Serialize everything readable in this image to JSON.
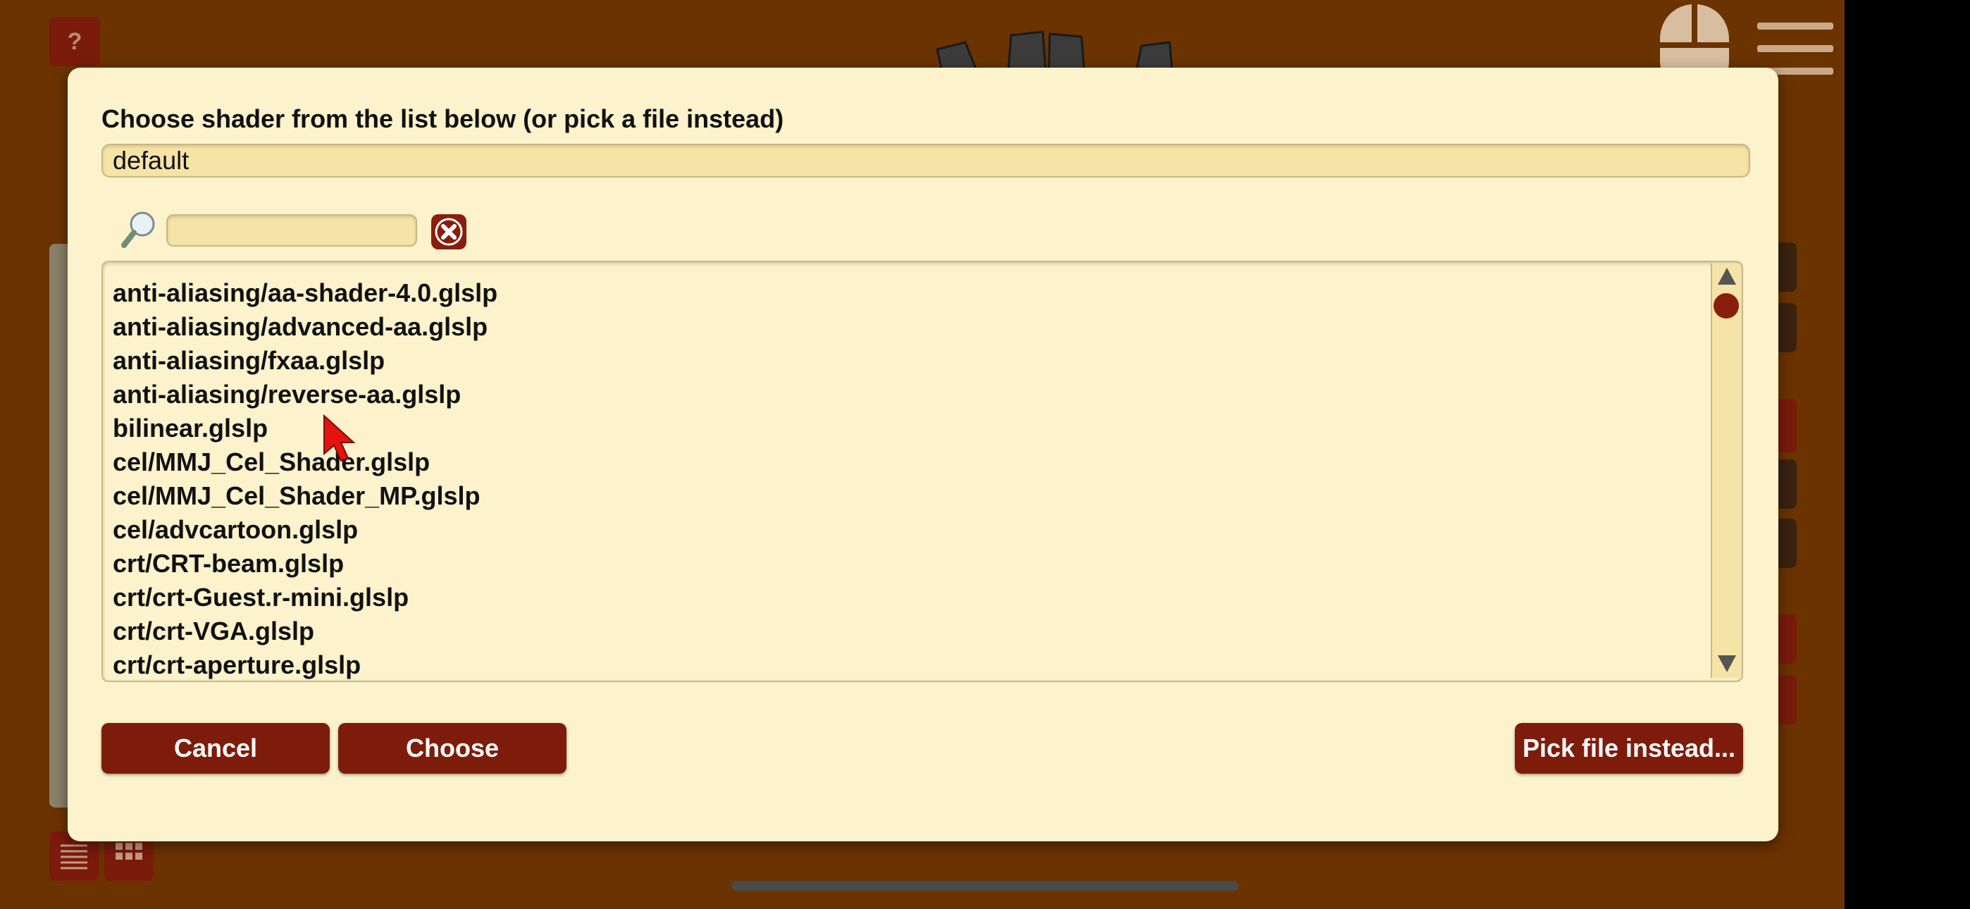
{
  "app": {
    "help_label": "?",
    "accent_color": "#7e1c0c",
    "background_color": "#6b3300"
  },
  "dialog": {
    "prompt": "Choose shader from the list below (or pick a file instead)",
    "selected_value": "default",
    "search": {
      "placeholder": "",
      "value": ""
    },
    "items": [
      "anti-aliasing/aa-shader-4.0.glslp",
      "anti-aliasing/advanced-aa.glslp",
      "anti-aliasing/fxaa.glslp",
      "anti-aliasing/reverse-aa.glslp",
      "bilinear.glslp",
      "cel/MMJ_Cel_Shader.glslp",
      "cel/MMJ_Cel_Shader_MP.glslp",
      "cel/advcartoon.glslp",
      "crt/CRT-beam.glslp",
      "crt/crt-Guest.r-mini.glslp",
      "crt/crt-VGA.glslp",
      "crt/crt-aperture.glslp"
    ],
    "buttons": {
      "cancel": "Cancel",
      "choose": "Choose",
      "pick_file": "Pick file instead..."
    }
  }
}
